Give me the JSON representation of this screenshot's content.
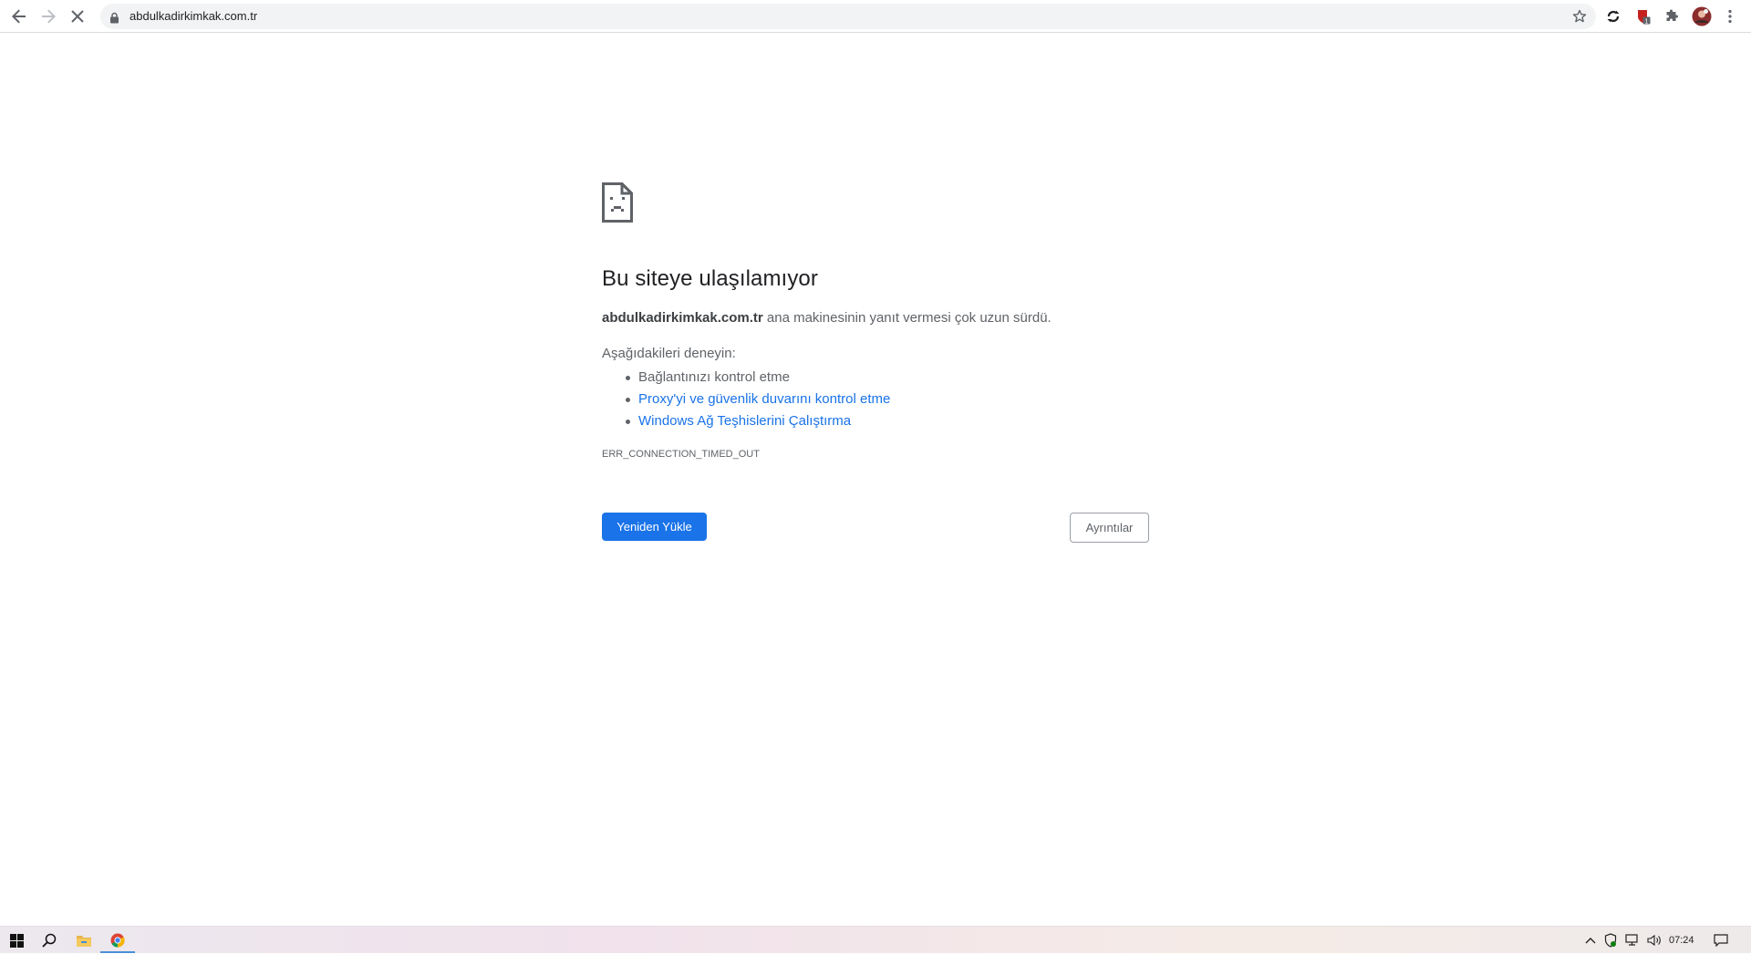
{
  "browser": {
    "url": "abdulkadirkimkak.com.tr",
    "icons": [
      "back-icon",
      "forward-icon",
      "stop-loading-icon",
      "lock-icon",
      "bookmark-star-icon",
      "sync-extension-icon",
      "shield-extension-icon",
      "extensions-puzzle-icon",
      "profile-avatar",
      "menu-kebab-icon"
    ]
  },
  "error_page": {
    "title": "Bu siteye ulaşılamıyor",
    "host": "abdulkadirkimkak.com.tr",
    "description_suffix": " ana makinesinin yanıt vermesi çok uzun sürdü.",
    "try_heading": "Aşağıdakileri deneyin:",
    "suggestions": [
      "Bağlantınızı kontrol etme",
      "Proxy'yi ve güvenlik duvarını kontrol etme",
      "Windows Ağ Teşhislerini Çalıştırma"
    ],
    "error_code": "ERR_CONNECTION_TIMED_OUT",
    "reload_label": "Yeniden Yükle",
    "details_label": "Ayrıntılar"
  },
  "taskbar": {
    "clock": "07:24",
    "colors": {
      "accent": "#1a73e8"
    }
  }
}
